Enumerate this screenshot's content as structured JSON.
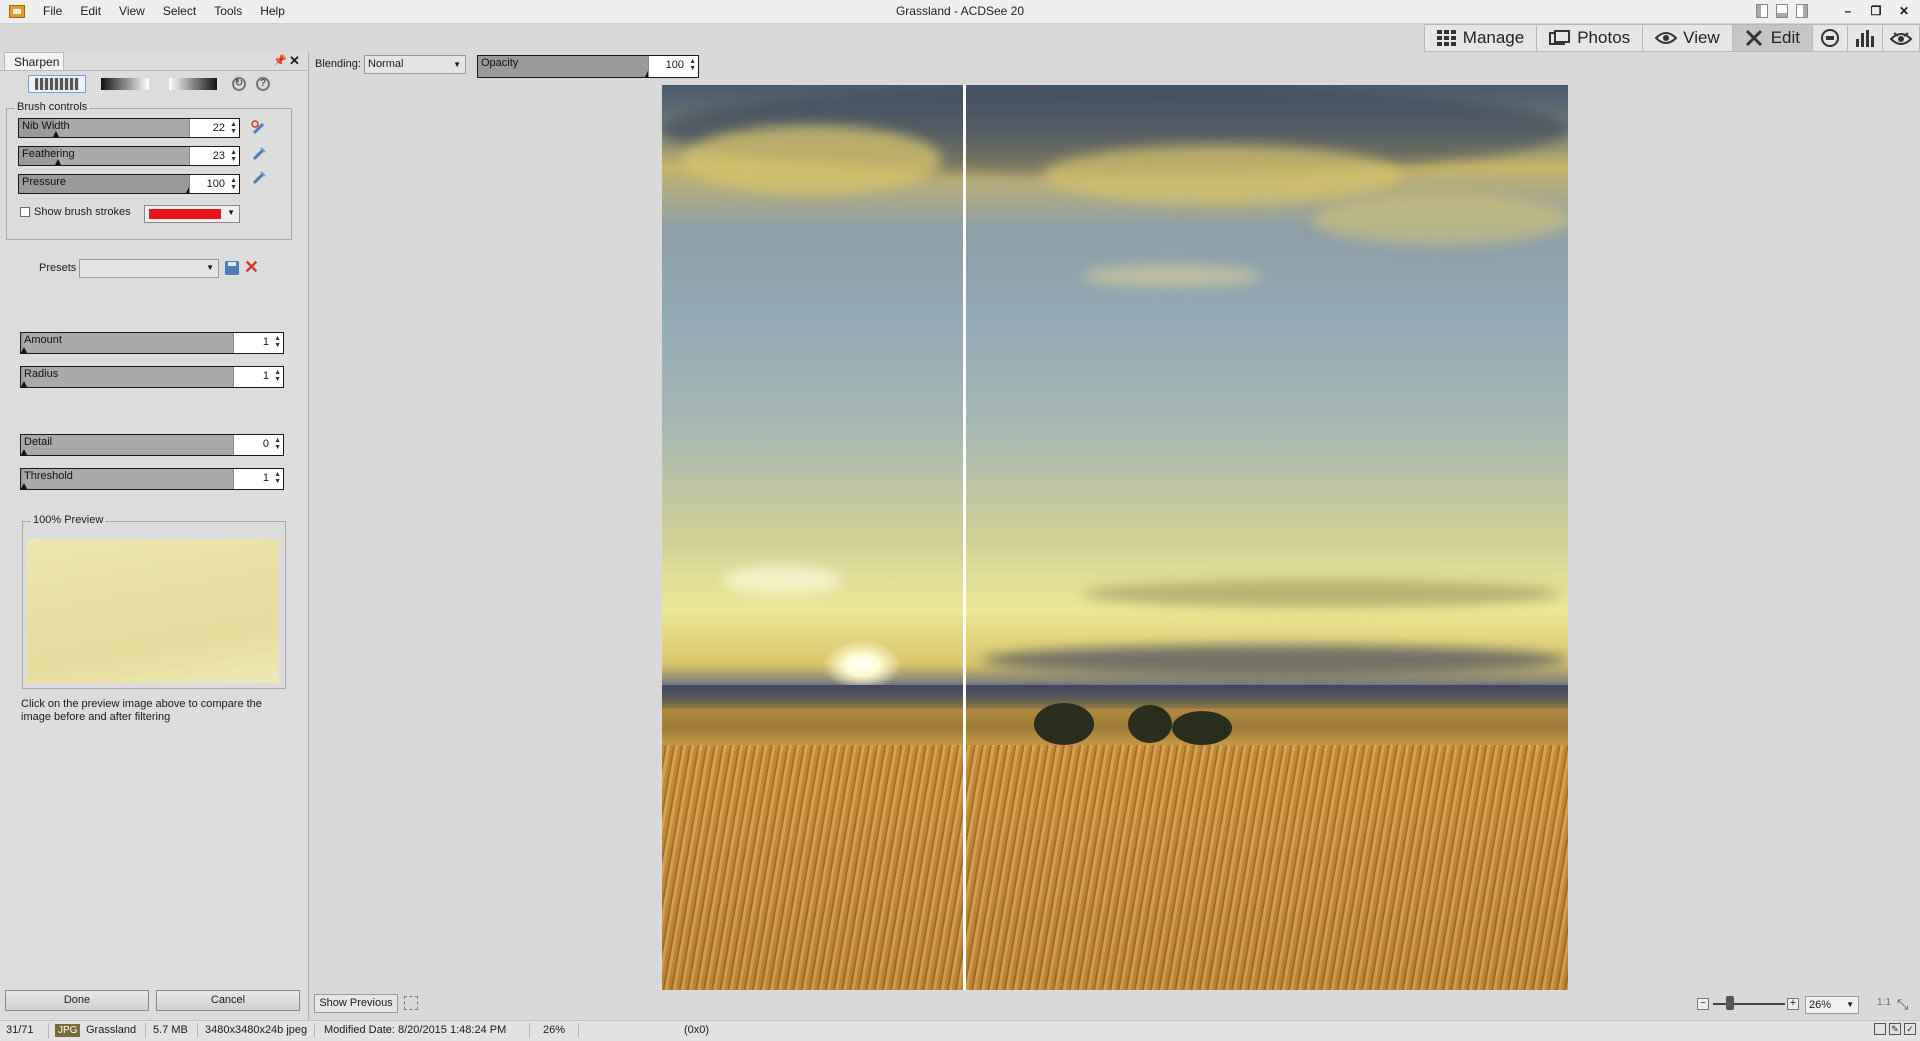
{
  "window": {
    "title": "Grassland - ACDSee 20"
  },
  "menu": [
    "File",
    "Edit",
    "View",
    "Select",
    "Tools",
    "Help"
  ],
  "modes": {
    "manage": "Manage",
    "photos": "Photos",
    "view": "View",
    "edit": "Edit",
    "active": "Edit"
  },
  "panel": {
    "tab": "Sharpen",
    "brush_controls": {
      "legend": "Brush controls",
      "nib_width": {
        "label": "Nib Width",
        "value": "22",
        "level": 0.22
      },
      "feathering": {
        "label": "Feathering",
        "value": "23",
        "level": 0.23
      },
      "pressure": {
        "label": "Pressure",
        "value": "100",
        "level": 1.0
      },
      "show_strokes_label": "Show brush strokes",
      "stroke_color": "#e8141a"
    },
    "presets_label": "Presets",
    "presets_value": "",
    "amount": {
      "label": "Amount",
      "value": "1",
      "level": 0.01
    },
    "radius": {
      "label": "Radius",
      "value": "1",
      "level": 0.01
    },
    "detail": {
      "label": "Detail",
      "value": "0",
      "level": 0.0
    },
    "threshold": {
      "label": "Threshold",
      "value": "1",
      "level": 0.01
    },
    "preview_legend": "100% Preview",
    "preview_note": "Click on the preview image above to compare the image before and after filtering",
    "done_label": "Done",
    "cancel_label": "Cancel"
  },
  "edit_toolbar": {
    "blending_label": "Blending:",
    "blending_value": "Normal",
    "opacity_label": "Opacity",
    "opacity_value": "100",
    "opacity_level": 1.0
  },
  "bottom": {
    "show_previous": "Show Previous",
    "zoom": "26%",
    "actual_size": "1:1"
  },
  "status": {
    "position": "31/71",
    "format": "JPG",
    "name": "Grassland",
    "size": "5.7 MB",
    "dims": "3480x3480x24b jpeg",
    "modified": "Modified Date: 8/20/2015 1:48:24 PM",
    "zoom": "26%",
    "coords": "(0x0)"
  }
}
